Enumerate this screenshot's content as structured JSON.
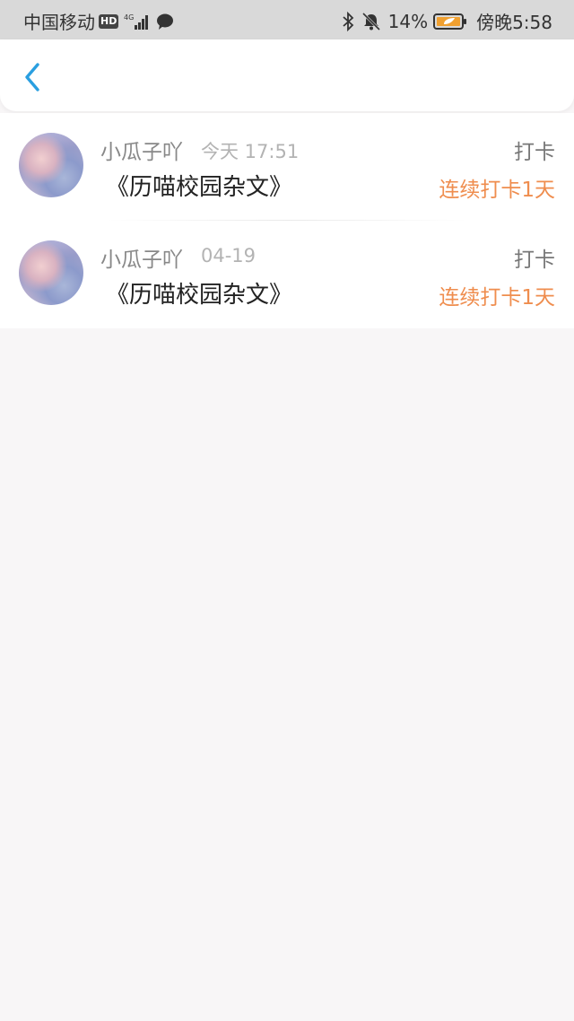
{
  "status_bar": {
    "carrier": "中国移动",
    "hd_badge": "HD",
    "network": "4G",
    "battery_percent": "14%",
    "time": "傍晚5:58"
  },
  "nav": {
    "back_icon": "chevron-left-icon",
    "accent_color": "#2a9fe0"
  },
  "checkins": [
    {
      "username": "小瓜子吖",
      "time": "今天 17:51",
      "action": "打卡",
      "title": "《历喵校园杂文》",
      "streak": "连续打卡1天"
    },
    {
      "username": "小瓜子吖",
      "time": "04-19",
      "action": "打卡",
      "title": "《历喵校园杂文》",
      "streak": "连续打卡1天"
    }
  ],
  "colors": {
    "streak": "#ef8d4e",
    "battery_fill": "#f0a030"
  }
}
